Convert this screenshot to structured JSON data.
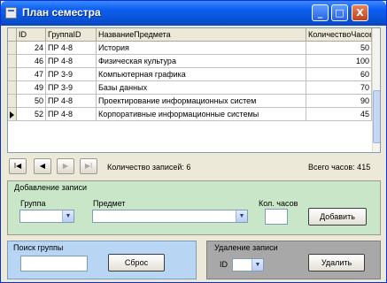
{
  "window": {
    "title": "План семестра",
    "minimize": "_",
    "maximize": "□",
    "close": "X"
  },
  "grid": {
    "columns": [
      "ID",
      "ГруппаID",
      "НазваниеПредмета",
      "КоличествоЧасов"
    ],
    "rows": [
      {
        "id": "24",
        "group": "ПР 4-8",
        "subject": "История",
        "hours": "50"
      },
      {
        "id": "46",
        "group": "ПР 4-8",
        "subject": "Физическая культура",
        "hours": "100"
      },
      {
        "id": "47",
        "group": "ПР 3-9",
        "subject": "Компьютерная графика",
        "hours": "60"
      },
      {
        "id": "49",
        "group": "ПР 3-9",
        "subject": "Базы данных",
        "hours": "70"
      },
      {
        "id": "50",
        "group": "ПР 4-8",
        "subject": "Проектирование информационных систем",
        "hours": "90"
      },
      {
        "id": "52",
        "group": "ПР 4-8",
        "subject": "Корпоративные информационные системы",
        "hours": "45"
      }
    ],
    "current_row_index": 5
  },
  "navigator": {
    "first": "I◀",
    "prev": "◀",
    "next": "▶",
    "last": "▶I",
    "records_text": "Количество записей: 6",
    "total_hours_text": "Всего часов: 415"
  },
  "add_panel": {
    "title": "Добавление записи",
    "group_label": "Группа",
    "group_value": "",
    "subject_label": "Предмет",
    "subject_value": "",
    "hours_label": "Кол. часов",
    "hours_value": "",
    "add_button": "Добавить"
  },
  "search_panel": {
    "title": "Поиск группы",
    "value": "",
    "reset_button": "Сброс"
  },
  "delete_panel": {
    "title": "Удаление записи",
    "id_label": "ID",
    "id_value": "",
    "delete_button": "Удалить"
  },
  "colors": {
    "add_bg": "#c9e7c8",
    "search_bg": "#b8d5f3",
    "delete_bg": "#a8a8a8"
  }
}
